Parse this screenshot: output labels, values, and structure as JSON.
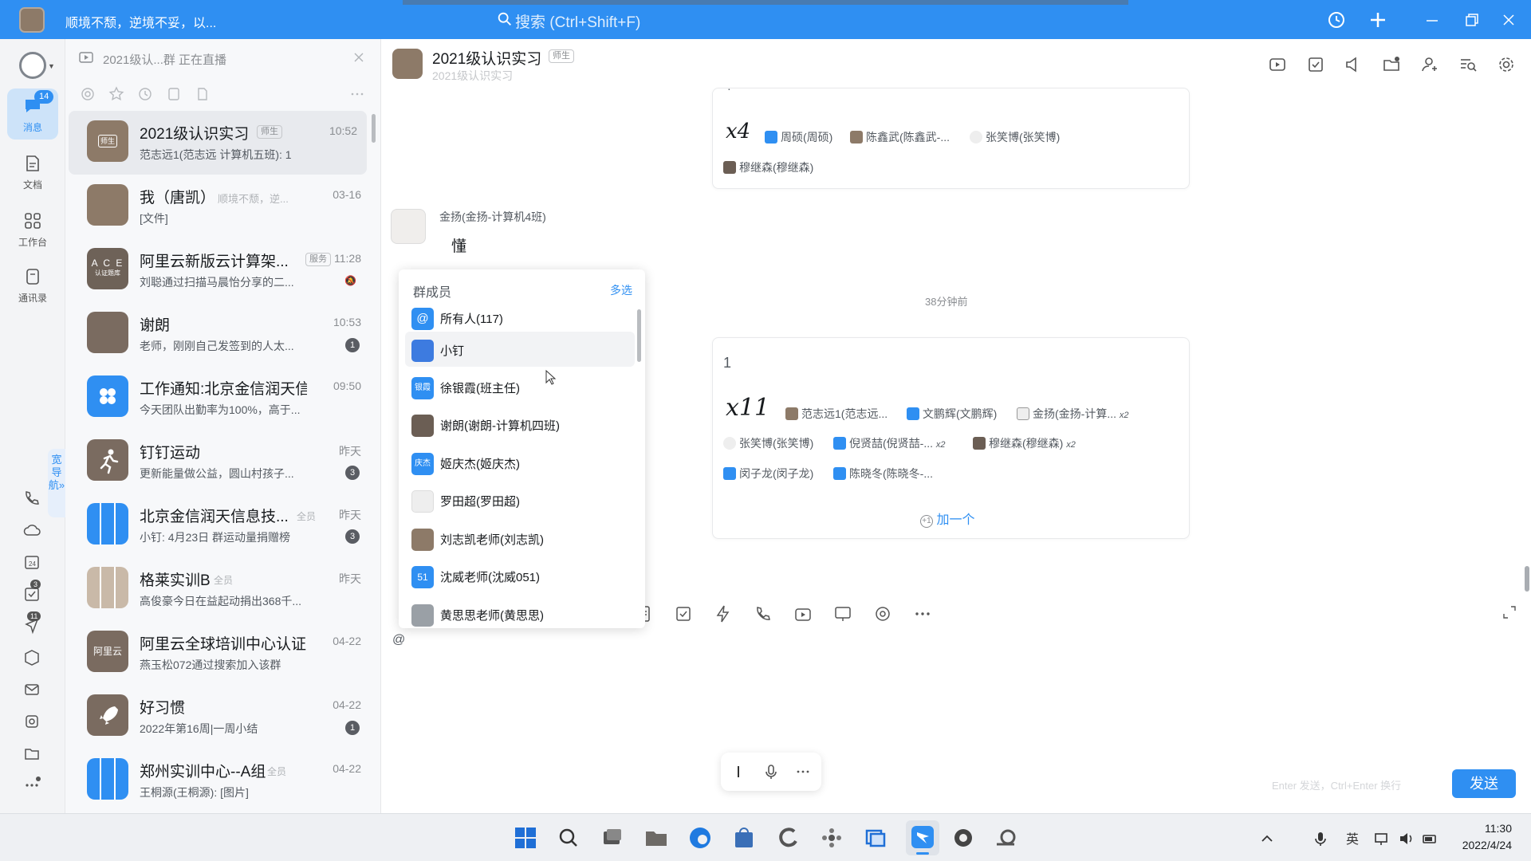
{
  "titlebar": {
    "status_text": "顺境不颓，逆境不妥，以...",
    "search_placeholder": "搜索 (Ctrl+Shift+F)"
  },
  "nav": {
    "items": [
      {
        "label": "消息",
        "badge": "14"
      },
      {
        "label": "文档"
      },
      {
        "label": "工作台"
      },
      {
        "label": "通讯录"
      }
    ],
    "guide_tab": "宽导航»",
    "small_badges": {
      "todo": "3",
      "ding": "11"
    }
  },
  "live_bar": {
    "text": "2021级认...群 正在直播"
  },
  "conversations": [
    {
      "title": "2021级认识实习",
      "tag": "师生",
      "time": "10:52",
      "preview": "范志远1(范志远 计算机五班): 1",
      "badge": ""
    },
    {
      "title": "我（唐凯）",
      "tag": "",
      "extra": "顺境不颓，逆...",
      "time": "03-16",
      "preview": "[文件]",
      "badge": ""
    },
    {
      "title": "阿里云新版云计算架...",
      "tag": "服务",
      "time": "11:28",
      "preview": "刘聪通过扫描马晨怡分享的二...",
      "badge": ""
    },
    {
      "title": "谢朗",
      "tag": "",
      "time": "10:53",
      "preview": "老师，刚刚自己发签到的人太...",
      "badge": "1"
    },
    {
      "title": "工作通知:北京金信润天信...",
      "tag": "",
      "time": "09:50",
      "preview": "今天团队出勤率为100%，高于...",
      "badge": ""
    },
    {
      "title": "钉钉运动",
      "tag": "",
      "time": "昨天",
      "preview": "更新能量做公益，圆山村孩子...",
      "badge": "3"
    },
    {
      "title": "北京金信润天信息技...",
      "tag": "全员",
      "time": "昨天",
      "preview": "小钉: 4月23日 群运动量捐赠榜",
      "badge": "3"
    },
    {
      "title": "格莱实训B",
      "tag": "全员",
      "time": "昨天",
      "preview": "高俊豪今日在益起动捐出368千...",
      "badge": ""
    },
    {
      "title": "阿里云全球培训中心认证...",
      "tag": "",
      "time": "04-22",
      "preview": "燕玉松072通过搜索加入该群",
      "badge": ""
    },
    {
      "title": "好习惯",
      "tag": "",
      "time": "04-22",
      "preview": "2022年第16周|一周小结",
      "badge": "1"
    },
    {
      "title": "郑州实训中心--A组",
      "tag": "全员",
      "time": "04-22",
      "preview": "王桐源(王桐源): [图片]",
      "badge": ""
    }
  ],
  "conv_avatar_text": {
    "c0": "师生",
    "c2": "A C E",
    "c2b": "认证题库",
    "c8": "阿里云"
  },
  "chat": {
    "title": "2021级认识实习",
    "title_tag": "师生",
    "subtitle": "2021级认识实习",
    "card1": {
      "count": "x4",
      "readers": [
        "周硕(周硕)",
        "陈鑫武(陈鑫武-...",
        "张笑博(张笑博)",
        "穆继森(穆继森)"
      ]
    },
    "sender": "金扬(金扬-计算机4班)",
    "message": "懂",
    "time_sep": "38分钟前",
    "card2": {
      "text": "1",
      "count": "x11",
      "readers": [
        "范志远1(范志远...",
        "文鹏辉(文鹏辉)",
        "金扬(金扬-计算...",
        "张笑博(张笑博)",
        "倪贤喆(倪贤喆-...",
        "穆继森(穆继森)",
        "闵子龙(闵子龙)",
        "陈晓冬(陈晓冬-..."
      ],
      "mult_a": "x2",
      "mult_b": "x2",
      "mult_c": "x2",
      "add_one": "加一个"
    },
    "input_value": "@",
    "send_hint": "Enter 发送，Ctrl+Enter 换行",
    "send_label": "发送"
  },
  "members_popup": {
    "title": "群成员",
    "multi_select": "多选",
    "items": [
      {
        "name": "所有人(117)",
        "avatar": "@",
        "color": "#2f8ff2"
      },
      {
        "name": "小钉",
        "avatar": "",
        "color": "#3d7be0"
      },
      {
        "name": "徐银霞(班主任)",
        "avatar": "银霞",
        "color": "#2f8ff2"
      },
      {
        "name": "谢朗(谢朗-计算机四班)",
        "avatar": "",
        "color": "#6b5e54"
      },
      {
        "name": "姬庆杰(姬庆杰)",
        "avatar": "庆杰",
        "color": "#2f8ff2"
      },
      {
        "name": "罗田超(罗田超)",
        "avatar": "",
        "color": "#e9e9e9"
      },
      {
        "name": "刘志凯老师(刘志凯)",
        "avatar": "",
        "color": "#8d7a68"
      },
      {
        "name": "沈威老师(沈威051)",
        "avatar": "51",
        "color": "#2f8ff2"
      },
      {
        "name": "黄思思老师(黄思思)",
        "avatar": "",
        "color": "#9aa0a6"
      }
    ]
  },
  "taskbar": {
    "time": "11:30",
    "date": "2022/4/24",
    "ime": "英"
  }
}
